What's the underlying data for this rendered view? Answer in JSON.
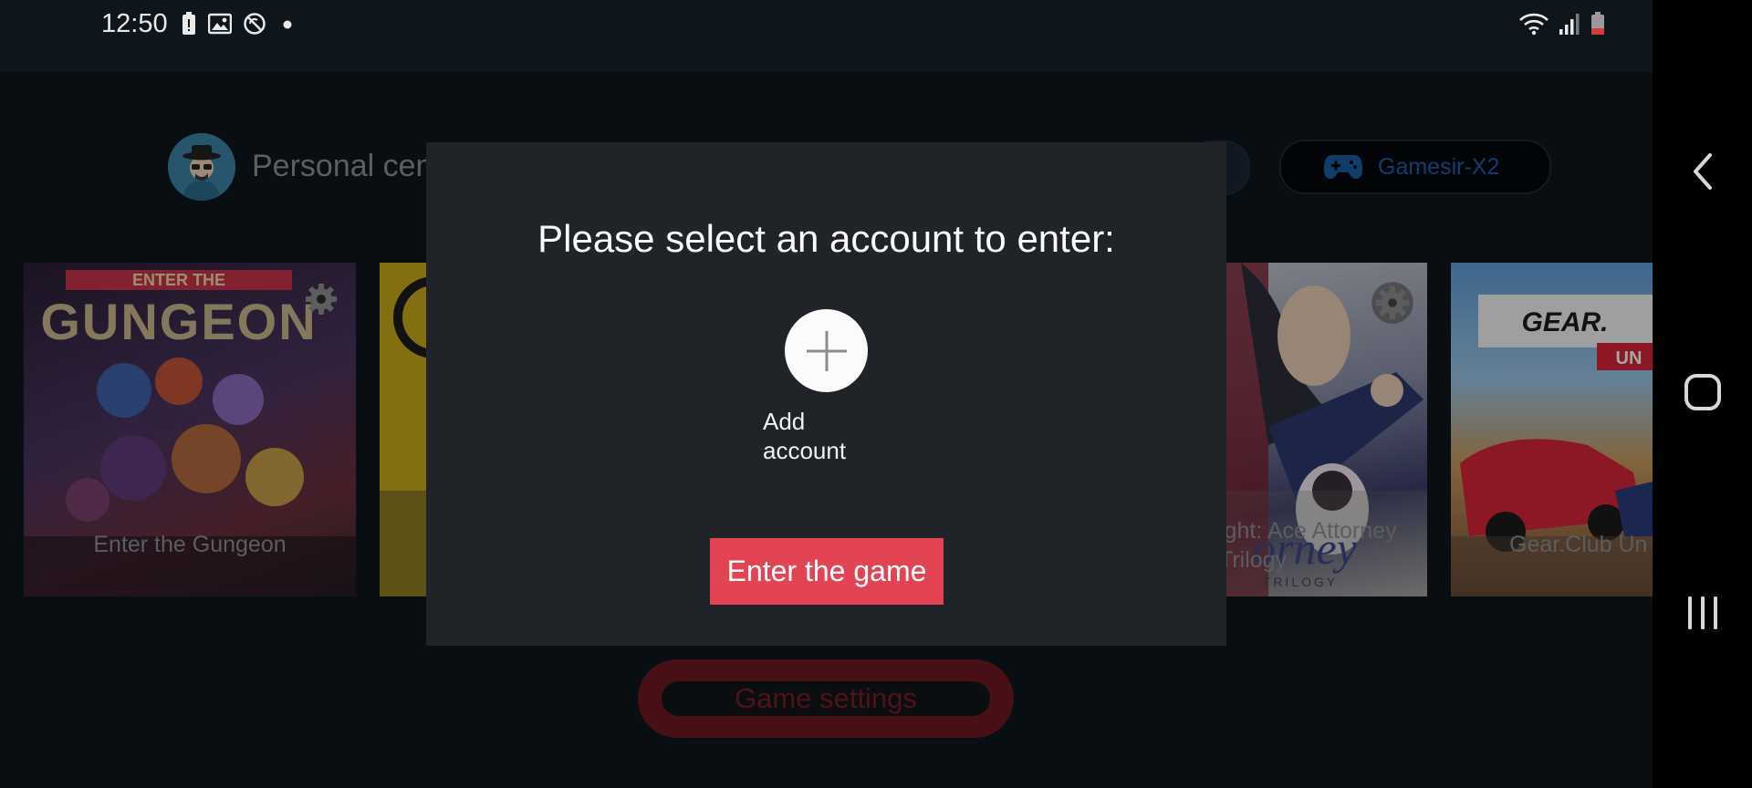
{
  "status_bar": {
    "time": "12:50",
    "left_icons": [
      "battery-alert-icon",
      "image-icon",
      "no-sync-icon",
      "dot-icon"
    ],
    "right_icons": [
      "wifi-icon",
      "signal-icon",
      "battery-low-icon"
    ]
  },
  "header": {
    "personal_center_label": "Personal cent",
    "device_label": "Gamesir-X2",
    "device_icon": "gamepad-icon",
    "accent_color": "#1d5ca3"
  },
  "games": [
    {
      "title": "Enter the Gungeon",
      "cover_text": "GUNGEON",
      "cover_subtext": "ENTER THE"
    },
    {
      "title": "",
      "cover_text": ""
    },
    {
      "title": "ight: Ace Attorney Trilogy",
      "cover_text": "orney",
      "cover_subtext": "TRILOGY"
    },
    {
      "title": "Gear.Club Un",
      "cover_text": "GEAR.",
      "cover_subtext": "UN"
    }
  ],
  "game_settings_label": "Game settings",
  "dialog": {
    "title": "Please select an account to enter:",
    "add_account_label": "Add account",
    "enter_button_label": "Enter the game",
    "enter_button_color": "#e34453"
  },
  "nav": {
    "back_icon": "back-chevron-icon",
    "home_icon": "home-square-icon",
    "recents_icon": "recents-lines-icon"
  }
}
